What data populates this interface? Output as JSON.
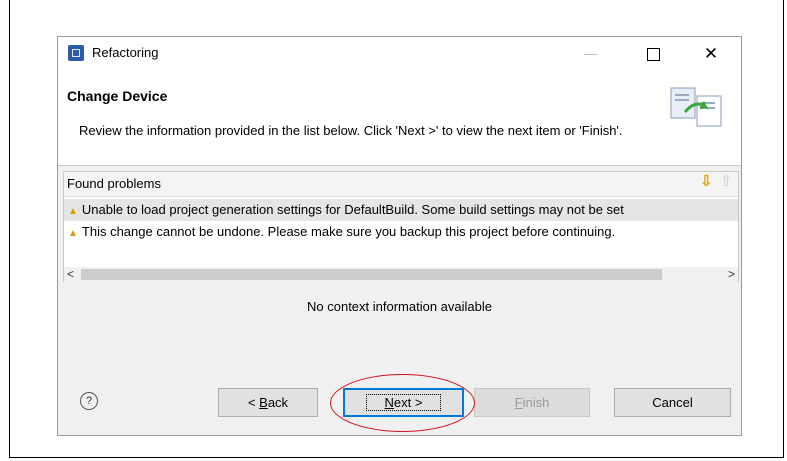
{
  "window": {
    "title": "Refactoring",
    "minimize_icon": "—",
    "close_icon": "✕"
  },
  "header": {
    "title": "Change Device",
    "description": "Review the information provided in the list below. Click 'Next >' to view the next item or 'Finish'."
  },
  "problems": {
    "title": "Found problems",
    "items": [
      {
        "text": "Unable to load project generation settings for DefaultBuild. Some build settings may not be set",
        "icon": "warning-icon"
      },
      {
        "text": "This change cannot be undone. Please make sure you backup this project before continuing.",
        "icon": "warning-icon"
      }
    ]
  },
  "context": {
    "message": "No context information available"
  },
  "buttons": {
    "back_prefix": "< ",
    "back_mnemonic": "B",
    "back_rest": "ack",
    "next_mnemonic": "N",
    "next_rest": "ext >",
    "finish_mnemonic": "F",
    "finish_rest": "inish",
    "cancel": "Cancel"
  },
  "help_symbol": "?",
  "colors": {
    "accent": "#0078d7",
    "warning": "#d79a00",
    "annotation": "#d0141f"
  }
}
